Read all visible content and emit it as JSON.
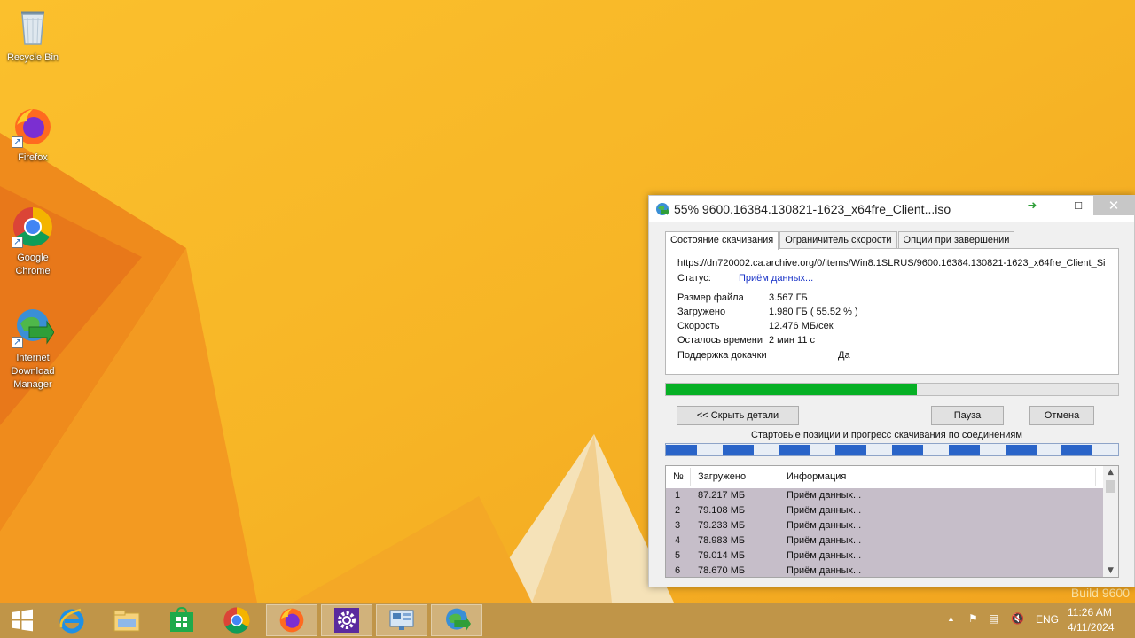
{
  "desktop": {
    "icons": [
      {
        "label": "Recycle Bin",
        "icon": "recycle-bin-icon"
      },
      {
        "label": "Firefox",
        "icon": "firefox-icon"
      },
      {
        "label": "Google Chrome",
        "icon": "chrome-icon"
      },
      {
        "label": "Internet Download Manager",
        "icon": "idm-icon"
      }
    ],
    "build_watermark": "Build 9600"
  },
  "idm": {
    "title": "55% 9600.16384.130821-1623_x64fre_Client...iso",
    "tabs": [
      "Состояние скачивания",
      "Ограничитель скорости",
      "Опции при завершении"
    ],
    "active_tab": 0,
    "url": "https://dn720002.ca.archive.org/0/items/Win8.1SLRUS/9600.16384.130821-1623_x64fre_Client_Si",
    "status_label": "Статус:",
    "status_value": "Приём данных...",
    "file_size_label": "Размер файла",
    "file_size_value": "3.567  ГБ",
    "downloaded_label": "Загружено",
    "downloaded_value": "1.980  ГБ  ( 55.52 % )",
    "speed_label": "Скорость",
    "speed_value": "12.476  МБ/сек",
    "time_left_label": "Осталось времени",
    "time_left_value": "2 мин 11 с",
    "resume_label": "Поддержка докачки",
    "resume_value": "Да",
    "progress_percent": 55.52,
    "hide_details_button": "<< Скрыть детали",
    "pause_button": "Пауза",
    "cancel_button": "Отмена",
    "connections_caption": "Стартовые позиции и прогресс скачивания по соединениям",
    "columns": [
      "№",
      "Загружено",
      "Информация"
    ],
    "connections": [
      {
        "n": "1",
        "downloaded": "87.217  МБ",
        "info": "Приём данных..."
      },
      {
        "n": "2",
        "downloaded": "79.108  МБ",
        "info": "Приём данных..."
      },
      {
        "n": "3",
        "downloaded": "79.233  МБ",
        "info": "Приём данных..."
      },
      {
        "n": "4",
        "downloaded": "78.983  МБ",
        "info": "Приём данных..."
      },
      {
        "n": "5",
        "downloaded": "79.014  МБ",
        "info": "Приём данных..."
      },
      {
        "n": "6",
        "downloaded": "78.670  МБ",
        "info": "Приём данных..."
      }
    ],
    "colors": {
      "progress": "#06b025",
      "connection_bar": "#2a64c8",
      "row_bg": "#c6bec9"
    }
  },
  "taskbar": {
    "apps": [
      "start-icon",
      "internet-explorer-icon",
      "file-explorer-icon",
      "store-icon",
      "chrome-icon",
      "firefox-icon",
      "settings-icon",
      "remote-desktop-icon",
      "idm-icon"
    ],
    "language": "ENG",
    "time": "11:26 AM",
    "date": "4/11/2024"
  }
}
